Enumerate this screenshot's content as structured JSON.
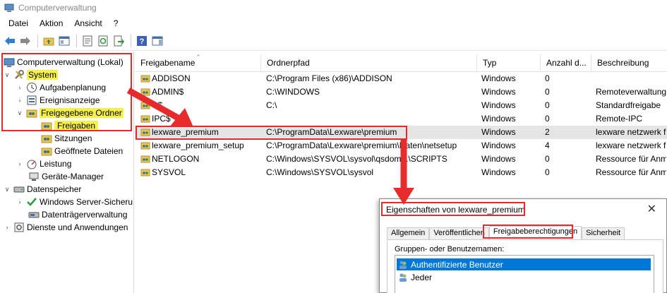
{
  "window": {
    "title": "Computerverwaltung"
  },
  "menu": {
    "items": [
      "Datei",
      "Aktion",
      "Ansicht",
      "?"
    ]
  },
  "tree": {
    "root": "Computerverwaltung (Lokal)",
    "system": "System",
    "aufgabenplanung": "Aufgabenplanung",
    "ereignisanzeige": "Ereignisanzeige",
    "freigegebene_ordner": "Freigegebene Ordner",
    "freigaben": "Freigaben",
    "sitzungen": "Sitzungen",
    "geoeffnete_dateien": "Geöffnete Dateien",
    "leistung": "Leistung",
    "geraete_manager": "Geräte-Manager",
    "datenspeicher": "Datenspeicher",
    "windows_server_sicherung": "Windows Server-Sicheru",
    "datentraegerverwaltung": "Datenträgerverwaltung",
    "dienste": "Dienste und Anwendungen"
  },
  "list": {
    "columns": [
      "Freigabename",
      "Ordnerpfad",
      "Typ",
      "Anzahl d...",
      "Beschreibung"
    ],
    "rows": [
      {
        "name": "ADDISON",
        "path": "C:\\Program Files (x86)\\ADDISON",
        "type": "Windows",
        "count": "0",
        "desc": ""
      },
      {
        "name": "ADMIN$",
        "path": "C:\\WINDOWS",
        "type": "Windows",
        "count": "0",
        "desc": "Remoteverwaltung"
      },
      {
        "name": "C$",
        "path": "C:\\",
        "type": "Windows",
        "count": "0",
        "desc": "Standardfreigabe"
      },
      {
        "name": "IPC$",
        "path": "",
        "type": "Windows",
        "count": "0",
        "desc": "Remote-IPC"
      },
      {
        "name": "lexware_premium",
        "path": "C:\\ProgramData\\Lexware\\premium",
        "type": "Windows",
        "count": "2",
        "desc": "lexware netzwerk fr"
      },
      {
        "name": "lexware_premium_setup",
        "path": "C:\\ProgramData\\Lexware\\premium\\Daten\\netsetup",
        "type": "Windows",
        "count": "4",
        "desc": "lexware netzwerk fr"
      },
      {
        "name": "NETLOGON",
        "path": "C:\\Windows\\SYSVOL\\sysvol\\qsdom...\\SCRIPTS",
        "type": "Windows",
        "count": "0",
        "desc": "Ressource für Anm"
      },
      {
        "name": "SYSVOL",
        "path": "C:\\Windows\\SYSVOL\\sysvol",
        "type": "Windows",
        "count": "0",
        "desc": "Ressource für Anm"
      }
    ]
  },
  "dialog": {
    "title": "Eigenschaften von lexware_premium",
    "tabs": [
      "Allgemein",
      "Veröffentlichen",
      "Freigabeberechtigungen",
      "Sicherheit"
    ],
    "group_label": "Gruppen- oder Benutzernamen:",
    "users": [
      "Authentifizierte Benutzer",
      "Jeder"
    ]
  },
  "colors": {
    "highlight": "#f5f04a",
    "annotation": "#e52b2b",
    "selection": "#0078d7"
  }
}
